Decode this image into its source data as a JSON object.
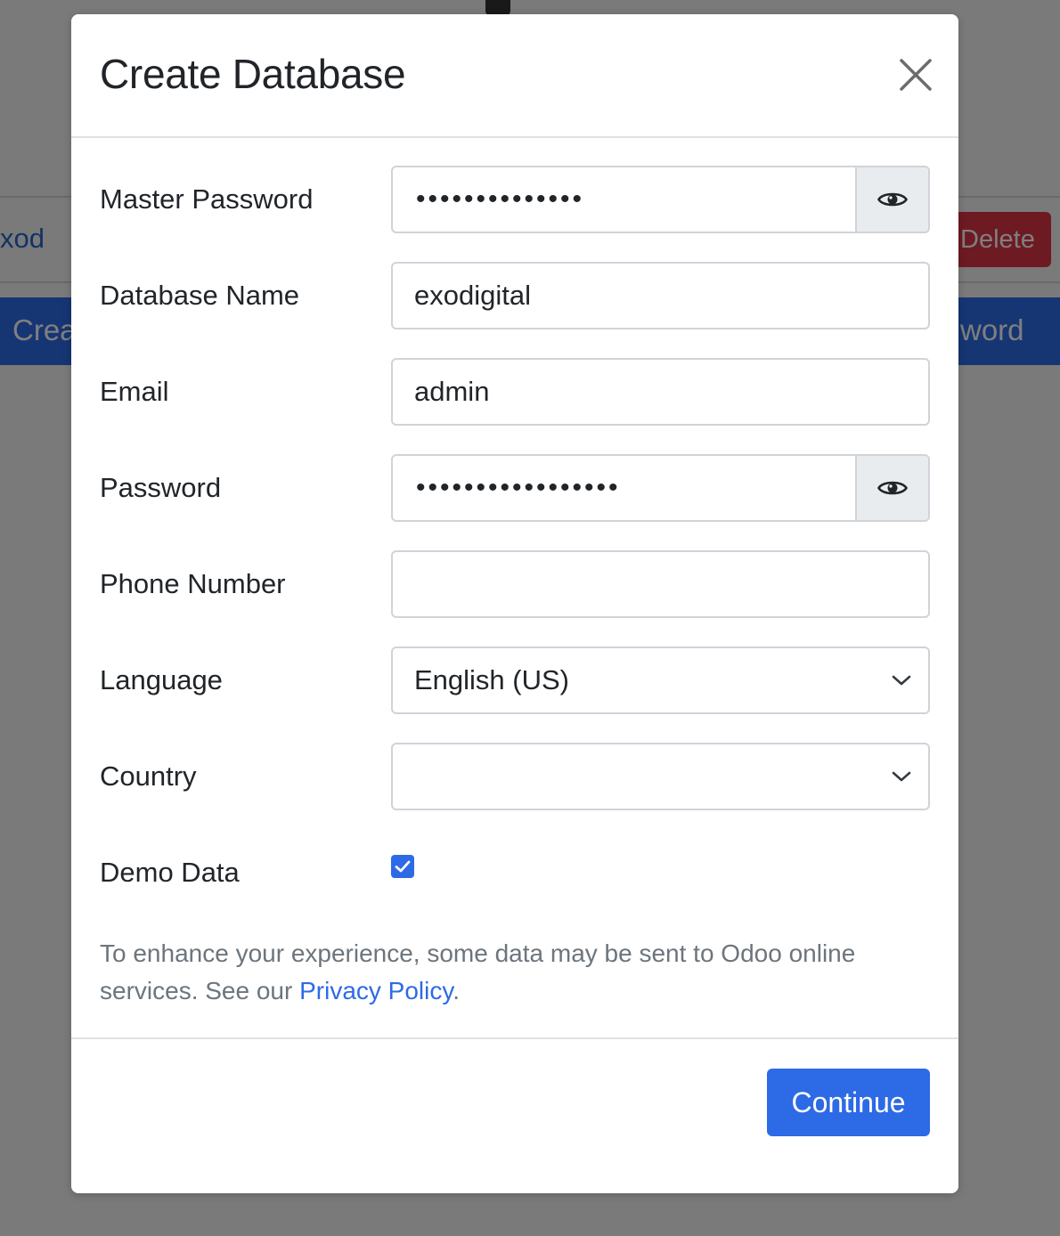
{
  "background": {
    "db_link_text": "xod",
    "delete_label": "Delete",
    "create_label": "Crea",
    "password_label_fragment": "word"
  },
  "modal": {
    "title": "Create Database",
    "fields": {
      "master_password": {
        "label": "Master Password",
        "value": "••••••••••••••"
      },
      "database_name": {
        "label": "Database Name",
        "value": "exodigital"
      },
      "email": {
        "label": "Email",
        "value": "admin"
      },
      "password": {
        "label": "Password",
        "value": "•••••••••••••••••"
      },
      "phone_number": {
        "label": "Phone Number",
        "value": ""
      },
      "language": {
        "label": "Language",
        "value": "English (US)"
      },
      "country": {
        "label": "Country",
        "value": ""
      },
      "demo_data": {
        "label": "Demo Data",
        "checked": true
      }
    },
    "notice": {
      "text": "To enhance your experience, some data may be sent to Odoo online services. See our ",
      "link": "Privacy Policy",
      "suffix": "."
    },
    "continue_label": "Continue"
  },
  "colors": {
    "primary": "#2d6ae6",
    "danger": "#dc3545",
    "muted_text": "#6c757d"
  },
  "icons": {
    "close": "close-icon",
    "reveal_password": "eye-icon",
    "select_arrow": "chevron-down-icon",
    "checkbox_check": "check-icon"
  }
}
